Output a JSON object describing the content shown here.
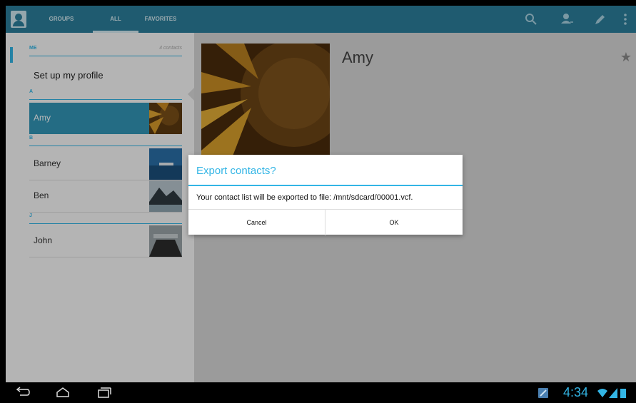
{
  "action_bar": {
    "tabs": [
      {
        "label": "GROUPS",
        "selected": false
      },
      {
        "label": "ALL",
        "selected": true
      },
      {
        "label": "FAVORITES",
        "selected": false
      }
    ],
    "actions": [
      "search-icon",
      "add-contact-icon",
      "edit-icon",
      "overflow-menu-icon"
    ]
  },
  "contact_list": {
    "me_header": "ME",
    "me_count": "4 contacts",
    "setup_profile": "Set up my profile",
    "section_a": "A",
    "section_b": "B",
    "section_j": "J",
    "contacts": [
      {
        "name": "Amy",
        "selected": true
      },
      {
        "name": "Barney",
        "selected": false
      },
      {
        "name": "Ben",
        "selected": false
      },
      {
        "name": "John",
        "selected": false
      }
    ]
  },
  "detail": {
    "name": "Amy",
    "star_icon": "star-icon"
  },
  "dialog": {
    "title": "Export contacts?",
    "message": "Your contact list will be exported to file: /mnt/sdcard/00001.vcf.",
    "cancel": "Cancel",
    "ok": "OK"
  },
  "system_bar": {
    "time": "4:34",
    "nav": [
      "back-icon",
      "home-icon",
      "recent-apps-icon"
    ]
  },
  "colors": {
    "accent": "#33b5e5",
    "action_bar": "#2b7f9b",
    "selected_row": "#3396b8"
  }
}
